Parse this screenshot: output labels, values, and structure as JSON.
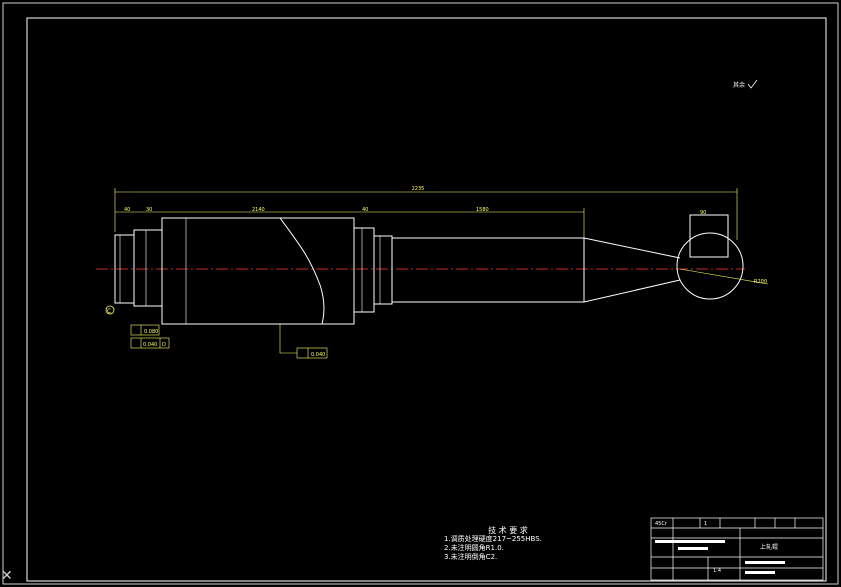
{
  "drawing": {
    "roughness_note": "其余",
    "dims": {
      "overall": "2235",
      "d1": "40",
      "d2": "30",
      "d3": "2140",
      "d4": "40",
      "d5": "1580",
      "d6": "90"
    },
    "tol_boxes": [
      "0.080",
      "0.040",
      "D",
      "0.040"
    ],
    "datum_letter": "C",
    "angle_label": "R200"
  },
  "tech_notes": {
    "title": "技 术 要 求",
    "lines": [
      "1.调质处理硬度217~255HBS.",
      "2.未注明圆角R1.0.",
      "3.未注明倒角C2."
    ]
  },
  "title_block": {
    "part_name": "上轧辊",
    "scale": "1:4",
    "material": "45Cr",
    "quantity": "1"
  },
  "colors": {
    "line": "#ffffff",
    "dim": "#ffff66",
    "centerline": "#ff3b2f",
    "border": "#ffffff"
  }
}
